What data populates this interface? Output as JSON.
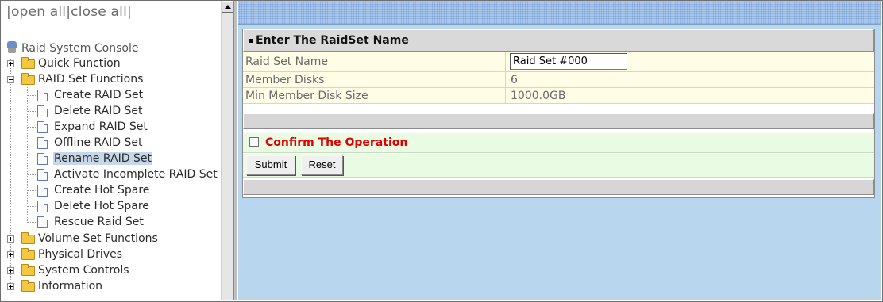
{
  "tree": {
    "open_all": "open all",
    "close_all": "close all",
    "root": "Raid System Console",
    "items": [
      {
        "label": "Quick Function"
      },
      {
        "label": "RAID Set Functions"
      },
      {
        "label": "Create RAID Set"
      },
      {
        "label": "Delete RAID Set"
      },
      {
        "label": "Expand RAID Set"
      },
      {
        "label": "Offline RAID Set"
      },
      {
        "label": "Rename RAID Set"
      },
      {
        "label": "Activate Incomplete RAID Set"
      },
      {
        "label": "Create Hot Spare"
      },
      {
        "label": "Delete Hot Spare"
      },
      {
        "label": "Rescue Raid Set"
      },
      {
        "label": "Volume Set Functions"
      },
      {
        "label": "Physical Drives"
      },
      {
        "label": "System Controls"
      },
      {
        "label": "Information"
      }
    ],
    "selected": "Rename RAID Set"
  },
  "form": {
    "section_title": "Enter The RaidSet Name",
    "rows": [
      {
        "label": "Raid Set Name",
        "value": "Raid Set #000"
      },
      {
        "label": "Member Disks",
        "value": "6"
      },
      {
        "label": "Min Member Disk Size",
        "value": "1000.0GB"
      }
    ],
    "confirm_label": "Confirm The Operation",
    "confirm_checked": false,
    "submit_label": "Submit",
    "reset_label": "Reset"
  },
  "colors": {
    "form_row_bg": "#fffde6",
    "confirm_row_bg": "#e9fbe3",
    "confirm_text": "#e00000",
    "right_pane_bg": "#b8d6ee"
  }
}
